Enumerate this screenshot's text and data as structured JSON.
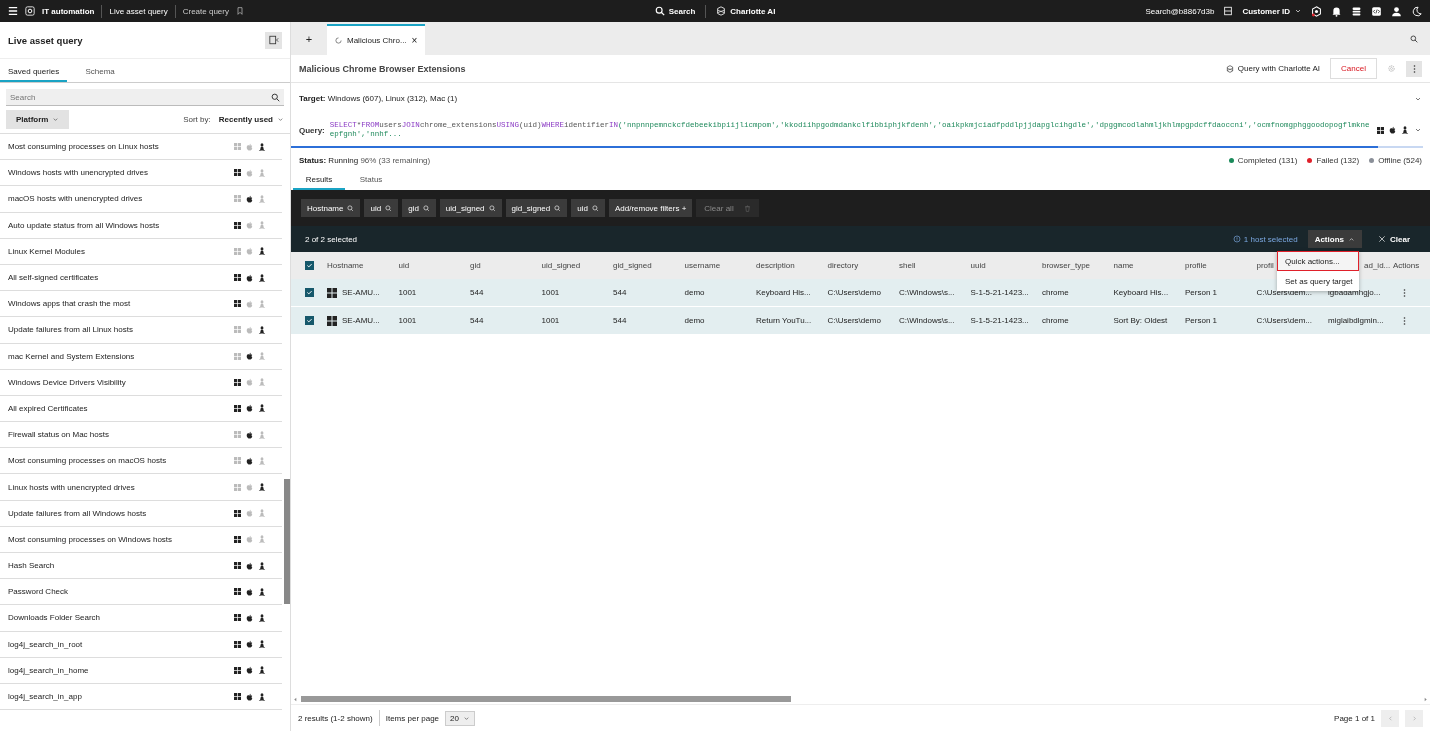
{
  "top_bar": {
    "app": "IT automation",
    "breadcrumb": "Live asset query",
    "create": "Create query",
    "search": "Search",
    "assistant": "Charlotte AI",
    "account": "Search@b8867d3b",
    "customer": "Customer ID"
  },
  "sidebar": {
    "title": "Live asset query",
    "tabs": [
      {
        "label": "Saved queries",
        "selected": true
      },
      {
        "label": "Schema",
        "selected": false
      }
    ],
    "search": {
      "placeholder": "Search"
    },
    "filter": "Platform",
    "sort_label": "Sort by:",
    "sort_value": "Recently used",
    "queries": [
      {
        "name": "Most consuming processes on Linux hosts",
        "windows": false,
        "mac": false,
        "linux": true
      },
      {
        "name": "Windows hosts with unencrypted drives",
        "windows": true,
        "mac": false,
        "linux": false
      },
      {
        "name": "macOS hosts with unencrypted drives",
        "windows": false,
        "mac": true,
        "linux": false
      },
      {
        "name": "Auto update status from all Windows hosts",
        "windows": true,
        "mac": false,
        "linux": false
      },
      {
        "name": "Linux Kernel Modules",
        "windows": false,
        "mac": false,
        "linux": true
      },
      {
        "name": "All self-signed certificates",
        "windows": true,
        "mac": true,
        "linux": true
      },
      {
        "name": "Windows apps that crash the most",
        "windows": true,
        "mac": false,
        "linux": false
      },
      {
        "name": "Update failures from all Linux hosts",
        "windows": false,
        "mac": false,
        "linux": true
      },
      {
        "name": "mac Kernel and System Extensions",
        "windows": false,
        "mac": true,
        "linux": false
      },
      {
        "name": "Windows Device Drivers Visibility",
        "windows": true,
        "mac": false,
        "linux": false
      },
      {
        "name": "All expired Certificates",
        "windows": true,
        "mac": true,
        "linux": true
      },
      {
        "name": "Firewall status on Mac hosts",
        "windows": false,
        "mac": true,
        "linux": false
      },
      {
        "name": "Most consuming processes on macOS hosts",
        "windows": false,
        "mac": true,
        "linux": false
      },
      {
        "name": "Linux hosts with unencrypted drives",
        "windows": false,
        "mac": false,
        "linux": true
      },
      {
        "name": "Update failures from all Windows hosts",
        "windows": true,
        "mac": false,
        "linux": false
      },
      {
        "name": "Most consuming processes on Windows hosts",
        "windows": true,
        "mac": false,
        "linux": false
      },
      {
        "name": "Hash Search",
        "windows": true,
        "mac": true,
        "linux": true
      },
      {
        "name": "Password Check",
        "windows": true,
        "mac": true,
        "linux": true
      },
      {
        "name": "Downloads Folder Search",
        "windows": true,
        "mac": true,
        "linux": true
      },
      {
        "name": "log4j_search_in_root",
        "windows": true,
        "mac": true,
        "linux": true
      },
      {
        "name": "log4j_search_in_home",
        "windows": true,
        "mac": true,
        "linux": true
      },
      {
        "name": "log4j_search_in_app",
        "windows": true,
        "mac": true,
        "linux": true
      }
    ]
  },
  "tabs": [
    {
      "add": "+",
      "label": "Malicious Chro...",
      "close": "×",
      "selected": true
    }
  ],
  "query": {
    "title": "Malicious Chrome Browser Extensions",
    "assistant_button": "Query with Charlotte AI",
    "cancel": "Cancel",
    "target_label": "Target:",
    "target": "Windows (607), Linux (312), Mac (1)",
    "query_label": "Query:",
    "segments": [
      {
        "kind": "keyword",
        "text": "SELECT"
      },
      {
        "kind": "plain",
        "text": "*"
      },
      {
        "kind": "keyword",
        "text": "FROM"
      },
      {
        "kind": "plain",
        "text": "users"
      },
      {
        "kind": "keyword",
        "text": "JOIN"
      },
      {
        "kind": "plain",
        "text": "chrome_extensions"
      },
      {
        "kind": "keyword",
        "text": "USING"
      },
      {
        "kind": "plain",
        "text": "(uid)"
      },
      {
        "kind": "keyword",
        "text": "WHERE"
      },
      {
        "kind": "plain",
        "text": "identifier"
      },
      {
        "kind": "keyword",
        "text": "IN"
      },
      {
        "kind": "string",
        "text": "('nnpnnpemnckcfdebeekibpiijlicmpom','kkodiihpgodmdankclfibbiphjkfdenh','oaikpkmjciadfpddlpjjdapglcihgdle','dpggmcodlahmljkhlmpgpdcffdaoccni','ocmfnomgphggoodopogflmkneepfgnh','nnhf..."
      }
    ],
    "progress": {
      "level": 0.96
    },
    "status_label": "Status:",
    "status": "Running",
    "status_detail": "96% (33 remaining)",
    "legend": [
      {
        "label": "Completed (131)",
        "color": "#1a8a5a"
      },
      {
        "label": "Failed (132)",
        "color": "#e0202a"
      },
      {
        "label": "Offline (524)",
        "color": "#8a8f98"
      }
    ]
  },
  "result_tabs": [
    {
      "label": "Results",
      "selected": true
    },
    {
      "label": "Status",
      "selected": false
    }
  ],
  "filters": [
    "Hostname",
    "uid",
    "gid",
    "uid_signed",
    "gid_signed",
    "uid"
  ],
  "add_filters": "Add/remove filters",
  "add_icon": "+",
  "clear_all": "Clear all",
  "selection": {
    "count": "2 of 2 selected",
    "hosts": "1 host selected",
    "actions": "Actions",
    "clear": "Clear"
  },
  "actions_menu": [
    {
      "label": "Quick actions...",
      "selected": true
    },
    {
      "label": "Set as query target",
      "selected": false
    }
  ],
  "table": {
    "all_checked": true,
    "columns": [
      "Hostname",
      "uid",
      "gid",
      "uid_signed",
      "gid_signed",
      "username",
      "description",
      "directory",
      "shell",
      "uuid",
      "browser_type",
      "name",
      "profile",
      "profil",
      "ad_id...",
      "Actions"
    ],
    "rows": [
      {
        "checked": true,
        "cells": [
          "SE-AMU...",
          "1001",
          "544",
          "1001",
          "544",
          "demo",
          "Keyboard His...",
          "C:\\Users\\demo",
          "C:\\Windows\\s...",
          "S-1-5-21-1423...",
          "chrome",
          "Keyboard His...",
          "Person 1",
          "C:\\Users\\dem...",
          "igbadamhgjo..."
        ]
      },
      {
        "checked": true,
        "cells": [
          "SE-AMU...",
          "1001",
          "544",
          "1001",
          "544",
          "demo",
          "Return YouTu...",
          "C:\\Users\\demo",
          "C:\\Windows\\s...",
          "S-1-5-21-1423...",
          "chrome",
          "Sort By: Oldest",
          "Person 1",
          "C:\\Users\\dem...",
          "miglaibdlgmin..."
        ]
      }
    ]
  },
  "footer": {
    "results": "2 results (1-2 shown)",
    "per_page_label": "Items per page",
    "per_page": "20",
    "page": "Page 1 of 1"
  }
}
